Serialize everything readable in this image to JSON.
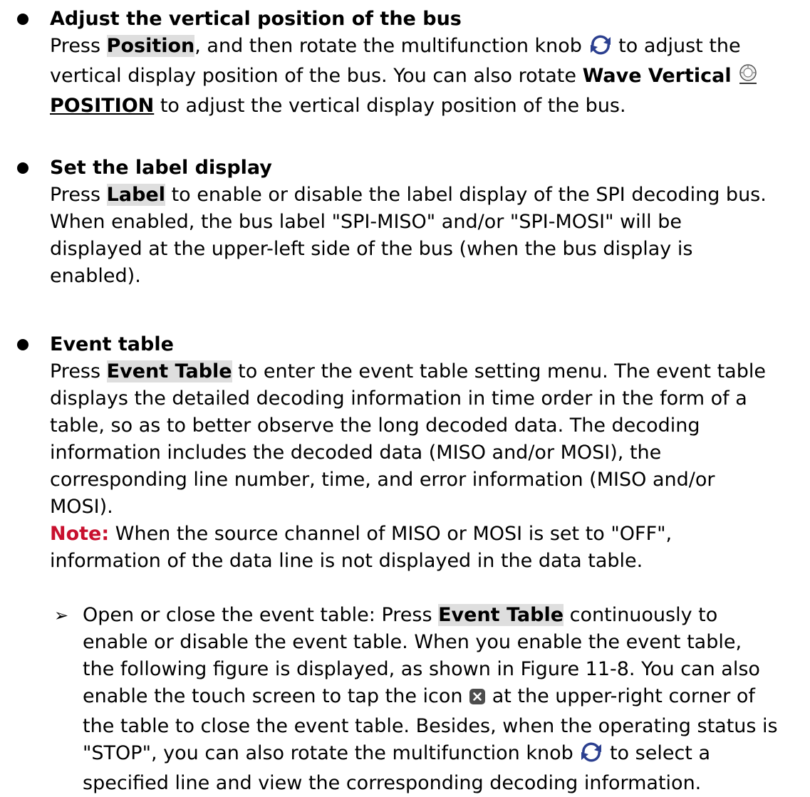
{
  "sections": [
    {
      "heading": "Adjust the vertical position of the bus",
      "line1": {
        "pre": "Press ",
        "button": "Position",
        "post": ", and then rotate the multifunction knob",
        "post2": "to adjust the"
      },
      "line2": {
        "pre": "vertical display position of the bus. You can also rotate ",
        "bold": "Wave Vertical"
      },
      "line3": {
        "underlined": "POSITION",
        "post": " to adjust the vertical display position of the bus."
      }
    },
    {
      "heading": "Set the label display",
      "line1": {
        "pre": "Press ",
        "button": "Label",
        "post": " to enable or disable the label display of the SPI decoding bus."
      },
      "lines": [
        "When enabled, the bus label \"SPI-MISO\" and/or \"SPI-MOSI\" will be",
        "displayed at the upper-left side of the bus (when the bus display is",
        "enabled)."
      ]
    },
    {
      "heading": "Event table",
      "line1": {
        "pre": "Press ",
        "button": "Event Table",
        "post": " to enter the event table setting menu. The event table"
      },
      "lines": [
        "displays the detailed decoding information in time order in the form of a",
        "table, so as to better observe the long decoded data. The decoding",
        "information includes the decoded data (MISO and/or MOSI), the",
        "corresponding line number, time, and error information (MISO and/or",
        "MOSI)."
      ],
      "note": {
        "label": "Note:",
        "line1": " When the source channel of MISO or MOSI is set to \"OFF\",",
        "line2": "information of the data line is not displayed in the data table."
      },
      "sub": {
        "arrow": "➢",
        "line1_pre": "Open or close the event table: Press ",
        "line1_button": "Event Table",
        "line1_post": " continuously to",
        "line2": "enable or disable the event table. When you enable the event table,",
        "line3": "the following figure is displayed, as shown in Figure 11-8. You can also",
        "line4_pre": "enable the touch screen to tap the icon",
        "line4_post": "at the upper-right corner of",
        "line5": "the table to close the event table. Besides, when the operating status is",
        "line6_pre": "\"STOP\", you can also rotate the multifunction knob",
        "line6_post": "to select a",
        "line7": "specified line and view the corresponding decoding information."
      }
    }
  ],
  "icons": {
    "knob": "rotate-arrows-icon",
    "vertical_knob": "position-knob-icon",
    "close": "close-icon"
  },
  "colors": {
    "note": "#c8102e",
    "button_highlight": "#dedede",
    "knob_icon": "#2b3f8f"
  }
}
